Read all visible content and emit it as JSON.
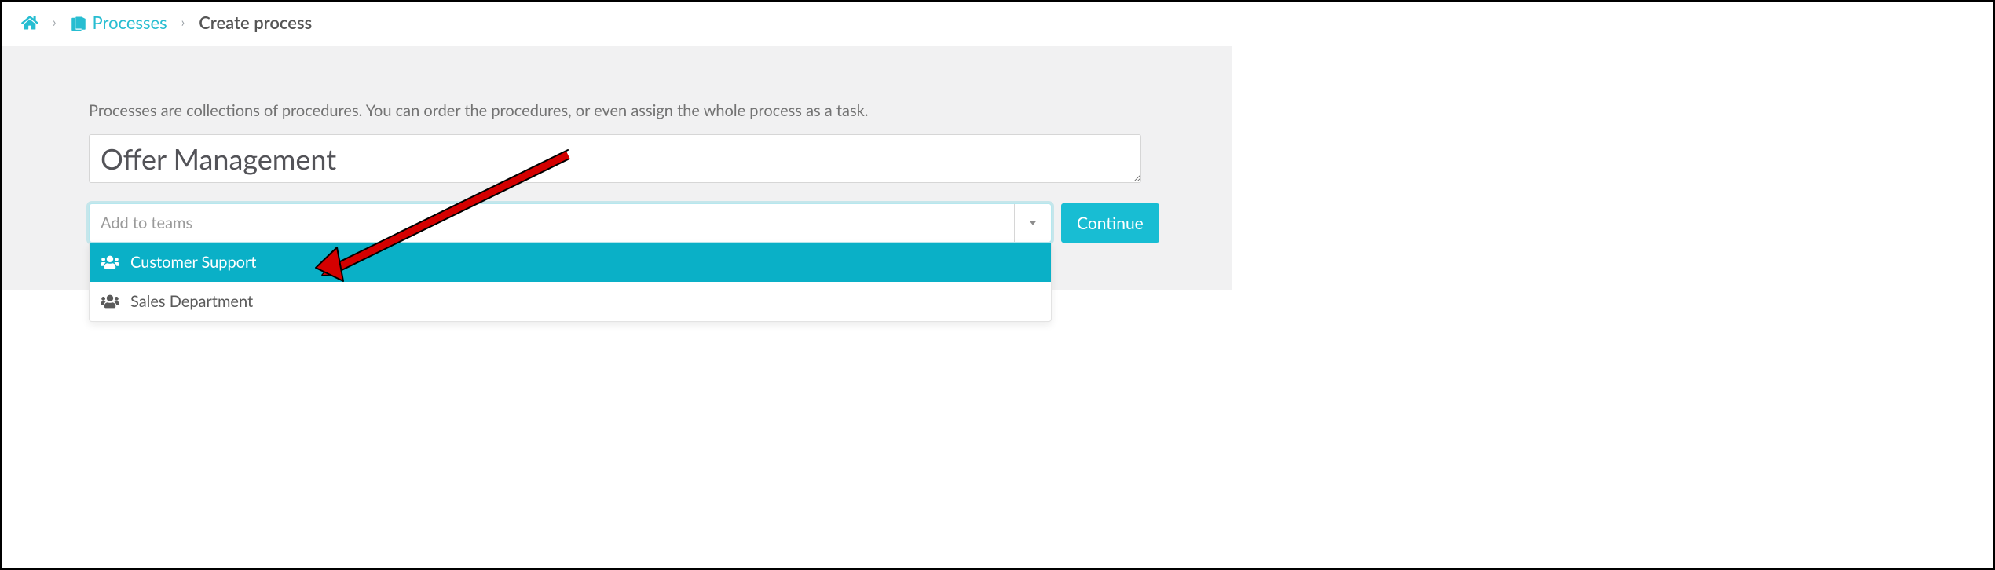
{
  "breadcrumb": {
    "home_label": "Home",
    "processes_label": "Processes",
    "current": "Create process"
  },
  "form": {
    "help_text": "Processes are collections of procedures. You can order the procedures, or even assign the whole process as a task.",
    "title_value": "Offer Management",
    "teams_placeholder": "Add to teams",
    "teams_options": [
      {
        "label": "Customer Support",
        "selected": true
      },
      {
        "label": "Sales Department",
        "selected": false
      }
    ],
    "continue_label": "Continue"
  },
  "colors": {
    "accent": "#18bdd3",
    "accent_dark": "#0ab0c7"
  }
}
